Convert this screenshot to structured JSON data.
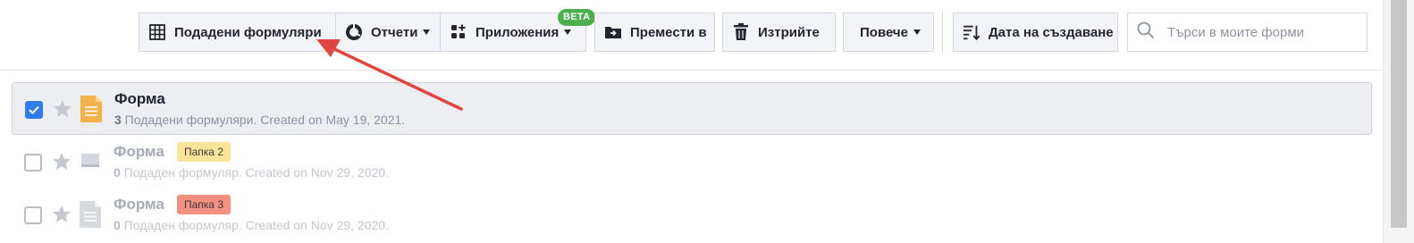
{
  "toolbar": {
    "submissions_label": "Подадени формуляри",
    "reports_label": "Отчети",
    "apps_label": "Приложения",
    "apps_badge": "BETA",
    "move_label": "Премести в",
    "delete_label": "Изтрийте",
    "more_label": "Повече",
    "sort_label": "Дата на създаване",
    "search_placeholder": "Търси в моите форми"
  },
  "forms": [
    {
      "title": "Форма",
      "count": "3",
      "meta": " Подадени формуляри. Created on May 19, 2021.",
      "selected": true,
      "starred": false,
      "icon": "orange-document-icon"
    },
    {
      "title": "Форма",
      "count": "0",
      "meta": " Подаден формуляр. Created on Nov 29, 2020.",
      "folder": "Папка 2",
      "folder_color": "#fbe49a",
      "selected": false,
      "icon": "gray-form-icon"
    },
    {
      "title": "Форма",
      "count": "0",
      "meta": " Подаден формуляр. Created on Nov 29, 2020.",
      "folder": "Папка 3",
      "folder_color": "#f4907f",
      "selected": false,
      "icon": "gray-document-icon"
    }
  ],
  "colors": {
    "accent": "#2e7de9",
    "beta": "#4caf50",
    "arrow": "#e0463f",
    "doc_orange": "#f6b24a"
  }
}
